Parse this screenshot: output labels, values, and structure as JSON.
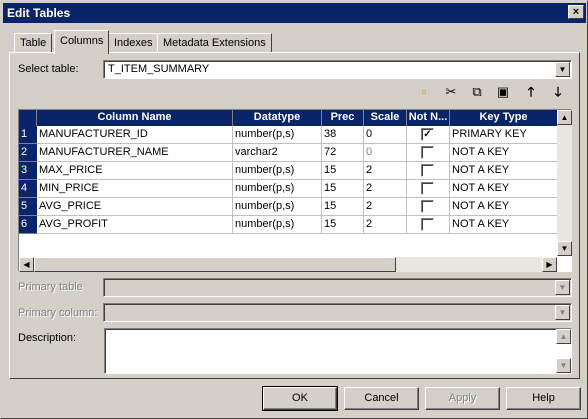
{
  "window": {
    "title": "Edit Tables",
    "close_glyph": "×"
  },
  "tabs": [
    {
      "label": "Table",
      "active": false
    },
    {
      "label": "Columns",
      "active": true
    },
    {
      "label": "Indexes",
      "active": false
    },
    {
      "label": "Metadata Extensions",
      "active": false
    }
  ],
  "select_table": {
    "label": "Select table:",
    "value": "T_ITEM_SUMMARY"
  },
  "toolbar": {
    "icons": [
      "new-icon",
      "cut-icon",
      "copy-icon",
      "paste-icon",
      "move-up-icon",
      "move-down-icon"
    ],
    "glyphs": [
      "▫",
      "✂",
      "⧉",
      "▣",
      "🡑",
      "🡓"
    ]
  },
  "grid": {
    "headers": [
      "Column Name",
      "Datatype",
      "Prec",
      "Scale",
      "Not N...",
      "Key Type"
    ],
    "rows": [
      {
        "num": "1",
        "name": "MANUFACTURER_ID",
        "datatype": "number(p,s)",
        "prec": "38",
        "scale": "0",
        "scale_dim": false,
        "not_null": true,
        "key_type": "PRIMARY KEY"
      },
      {
        "num": "2",
        "name": "MANUFACTURER_NAME",
        "datatype": "varchar2",
        "prec": "72",
        "scale": "0",
        "scale_dim": true,
        "not_null": false,
        "key_type": "NOT A KEY"
      },
      {
        "num": "3",
        "name": "MAX_PRICE",
        "datatype": "number(p,s)",
        "prec": "15",
        "scale": "2",
        "scale_dim": false,
        "not_null": false,
        "key_type": "NOT A KEY"
      },
      {
        "num": "4",
        "name": "MIN_PRICE",
        "datatype": "number(p,s)",
        "prec": "15",
        "scale": "2",
        "scale_dim": false,
        "not_null": false,
        "key_type": "NOT A KEY"
      },
      {
        "num": "5",
        "name": "AVG_PRICE",
        "datatype": "number(p,s)",
        "prec": "15",
        "scale": "2",
        "scale_dim": false,
        "not_null": false,
        "key_type": "NOT A KEY"
      },
      {
        "num": "6",
        "name": "AVG_PROFIT",
        "datatype": "number(p,s)",
        "prec": "15",
        "scale": "2",
        "scale_dim": false,
        "not_null": false,
        "key_type": "NOT A KEY"
      }
    ],
    "check_glyph": "✓"
  },
  "primary_table": {
    "label": "Primary table",
    "value": ""
  },
  "primary_column": {
    "label": "Primary column:",
    "value": ""
  },
  "description": {
    "label": "Description:",
    "value": ""
  },
  "buttons": {
    "ok": "OK",
    "cancel": "Cancel",
    "apply": "Apply",
    "help": "Help"
  },
  "scroll_glyphs": {
    "up": "▲",
    "down": "▼",
    "left": "◀",
    "right": "▶"
  }
}
